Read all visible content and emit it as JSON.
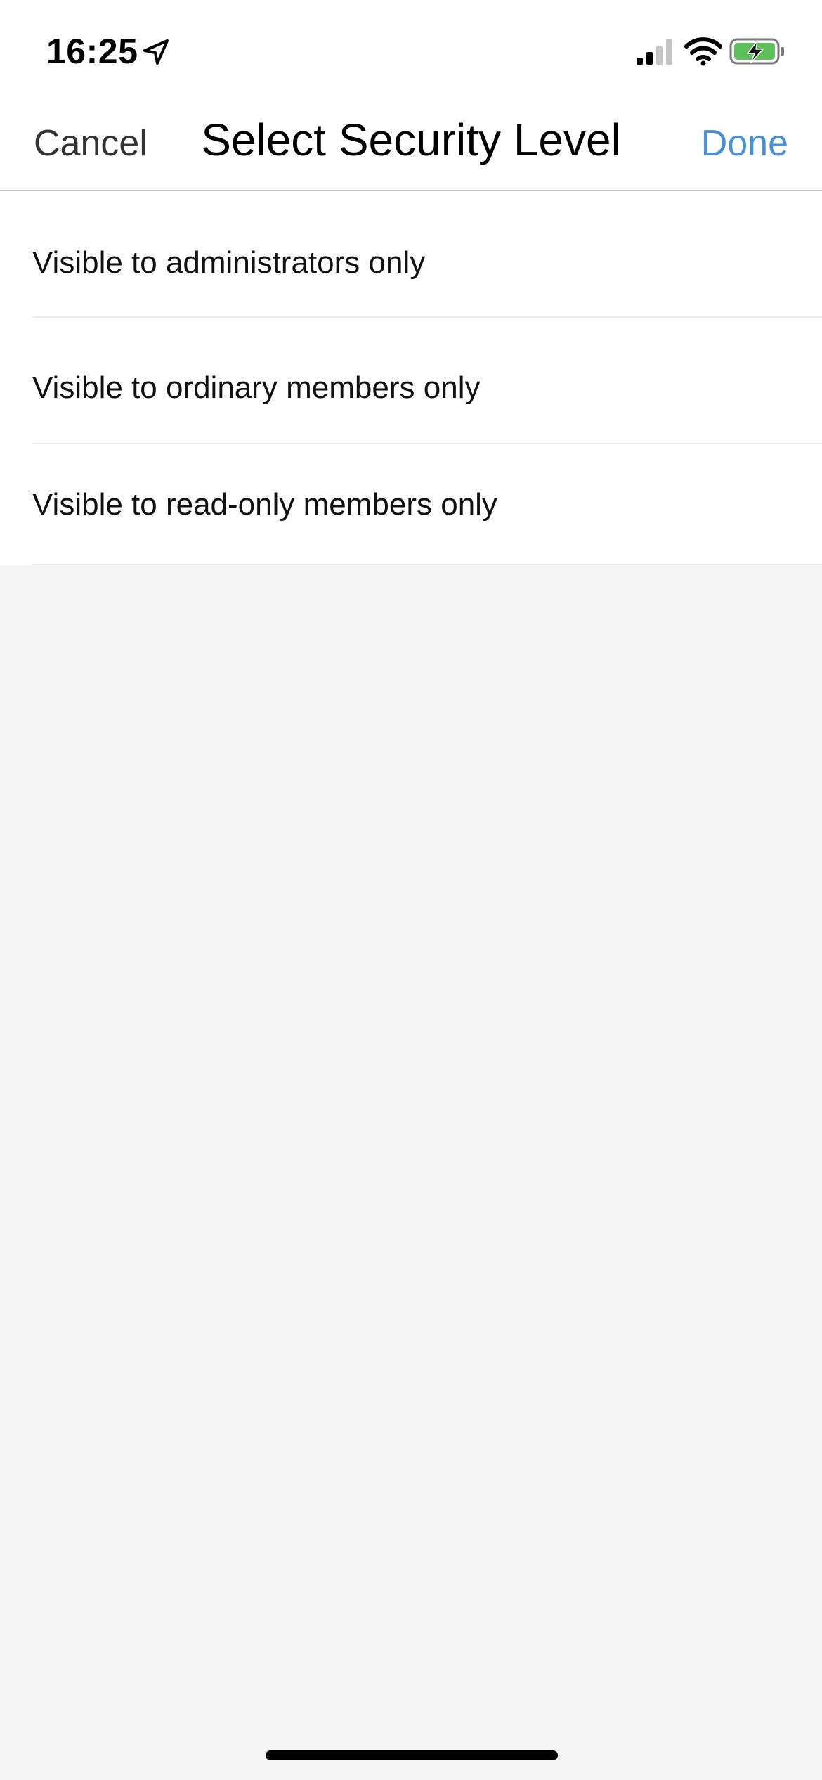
{
  "status_bar": {
    "time": "16:25",
    "location_icon": "location-arrow-icon",
    "signal_icon": "cellular-signal-icon",
    "wifi_icon": "wifi-icon",
    "battery_icon": "battery-charging-icon",
    "signal_bars_active": 2,
    "signal_bars_total": 4,
    "battery_color": "#5ec05a"
  },
  "nav": {
    "cancel_label": "Cancel",
    "title": "Select Security Level",
    "done_label": "Done",
    "done_color": "#4a90d9"
  },
  "options": [
    {
      "label": "Visible to administrators only"
    },
    {
      "label": "Visible to ordinary members only"
    },
    {
      "label": "Visible to read-only members only"
    }
  ]
}
